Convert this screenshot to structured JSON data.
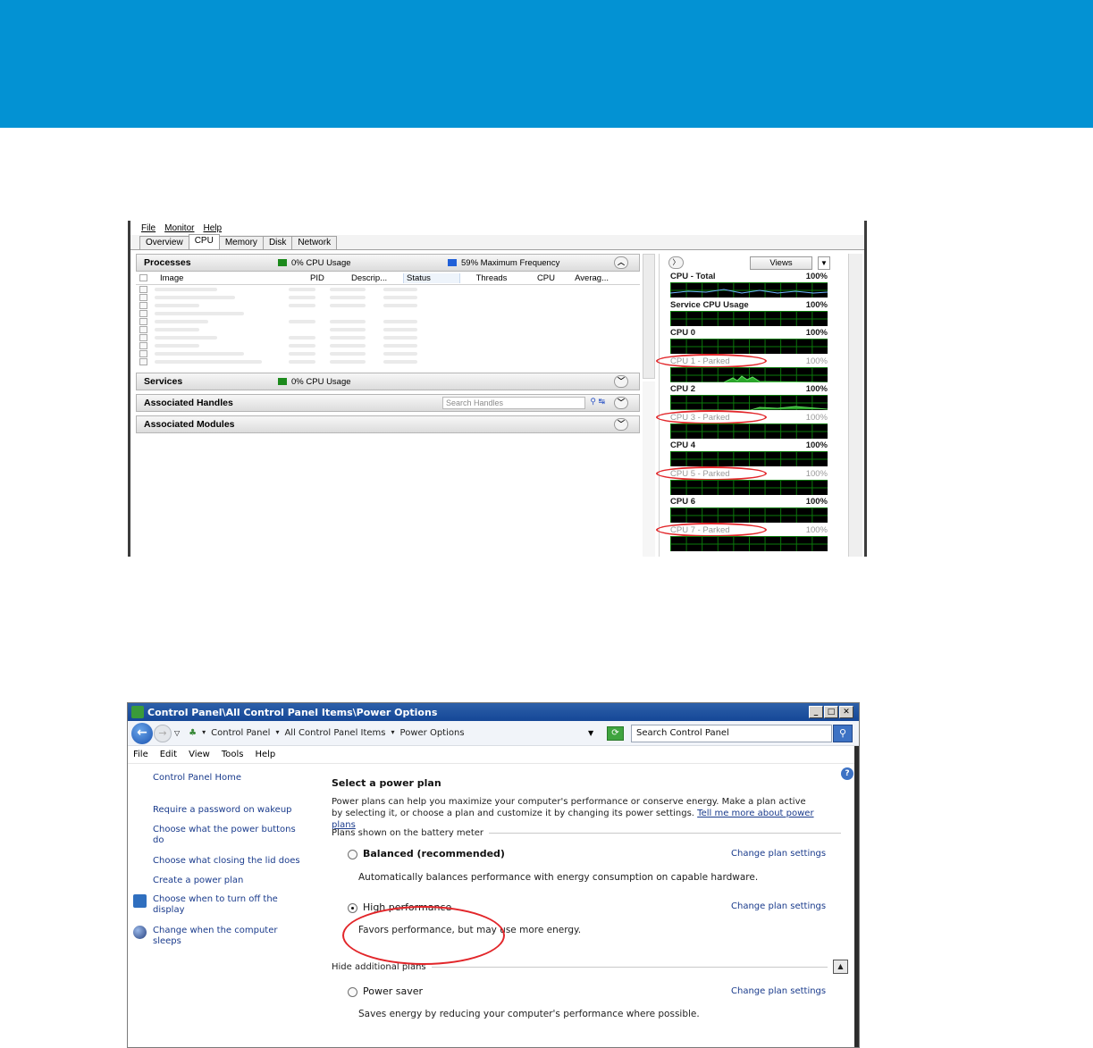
{
  "resource_monitor": {
    "menu": [
      "File",
      "Monitor",
      "Help"
    ],
    "tabs": [
      "Overview",
      "CPU",
      "Memory",
      "Disk",
      "Network"
    ],
    "active_tab": "CPU",
    "processes": {
      "title": "Processes",
      "cpu_usage": "0% CPU Usage",
      "max_frequency": "59% Maximum Frequency",
      "columns": [
        "Image",
        "PID",
        "Descrip...",
        "Status",
        "Threads",
        "CPU",
        "Averag..."
      ]
    },
    "services": {
      "title": "Services",
      "cpu_usage": "0% CPU Usage"
    },
    "handles": {
      "title": "Associated Handles",
      "search_placeholder": "Search Handles"
    },
    "modules": {
      "title": "Associated Modules"
    },
    "views_label": "Views",
    "graphs": [
      {
        "label": "CPU - Total",
        "pct": "100%",
        "parked": false
      },
      {
        "label": "Service CPU Usage",
        "pct": "100%",
        "parked": false
      },
      {
        "label": "CPU 0",
        "pct": "100%",
        "parked": false
      },
      {
        "label": "CPU 1 - Parked",
        "pct": "100%",
        "parked": true
      },
      {
        "label": "CPU 2",
        "pct": "100%",
        "parked": false
      },
      {
        "label": "CPU 3 - Parked",
        "pct": "100%",
        "parked": true
      },
      {
        "label": "CPU 4",
        "pct": "100%",
        "parked": false
      },
      {
        "label": "CPU 5 - Parked",
        "pct": "100%",
        "parked": true
      },
      {
        "label": "CPU 6",
        "pct": "100%",
        "parked": false
      },
      {
        "label": "CPU 7 - Parked",
        "pct": "100%",
        "parked": true
      }
    ]
  },
  "power_options": {
    "window_title": "Control Panel\\All Control Panel Items\\Power Options",
    "breadcrumbs": [
      "Control Panel",
      "All Control Panel Items",
      "Power Options"
    ],
    "search_placeholder": "Search Control Panel",
    "menu": [
      "File",
      "Edit",
      "View",
      "Tools",
      "Help"
    ],
    "sidebar": {
      "home": "Control Panel Home",
      "links": [
        "Require a password on wakeup",
        "Choose what the power buttons do",
        "Choose what closing the lid does",
        "Create a power plan",
        "Choose when to turn off the display",
        "Change when the computer sleeps"
      ]
    },
    "heading": "Select a power plan",
    "intro": "Power plans can help you maximize your computer's performance or conserve energy. Make a plan active by selecting it, or choose a plan and customize it by changing its power settings.",
    "intro_link": "Tell me more about power plans",
    "group_shown": "Plans shown on the battery meter",
    "group_hidden": "Hide additional plans",
    "change_label": "Change plan settings",
    "plans": [
      {
        "name": "Balanced (recommended)",
        "desc": "Automatically balances performance with energy consumption on capable hardware.",
        "selected": false
      },
      {
        "name": "High performance",
        "desc": "Favors performance, but may use more energy.",
        "selected": true
      },
      {
        "name": "Power saver",
        "desc": "Saves energy by reducing your computer's performance where possible.",
        "selected": false
      }
    ],
    "colors": {
      "banner": "#0392d3",
      "highlight_ring": "#e2262a"
    }
  }
}
